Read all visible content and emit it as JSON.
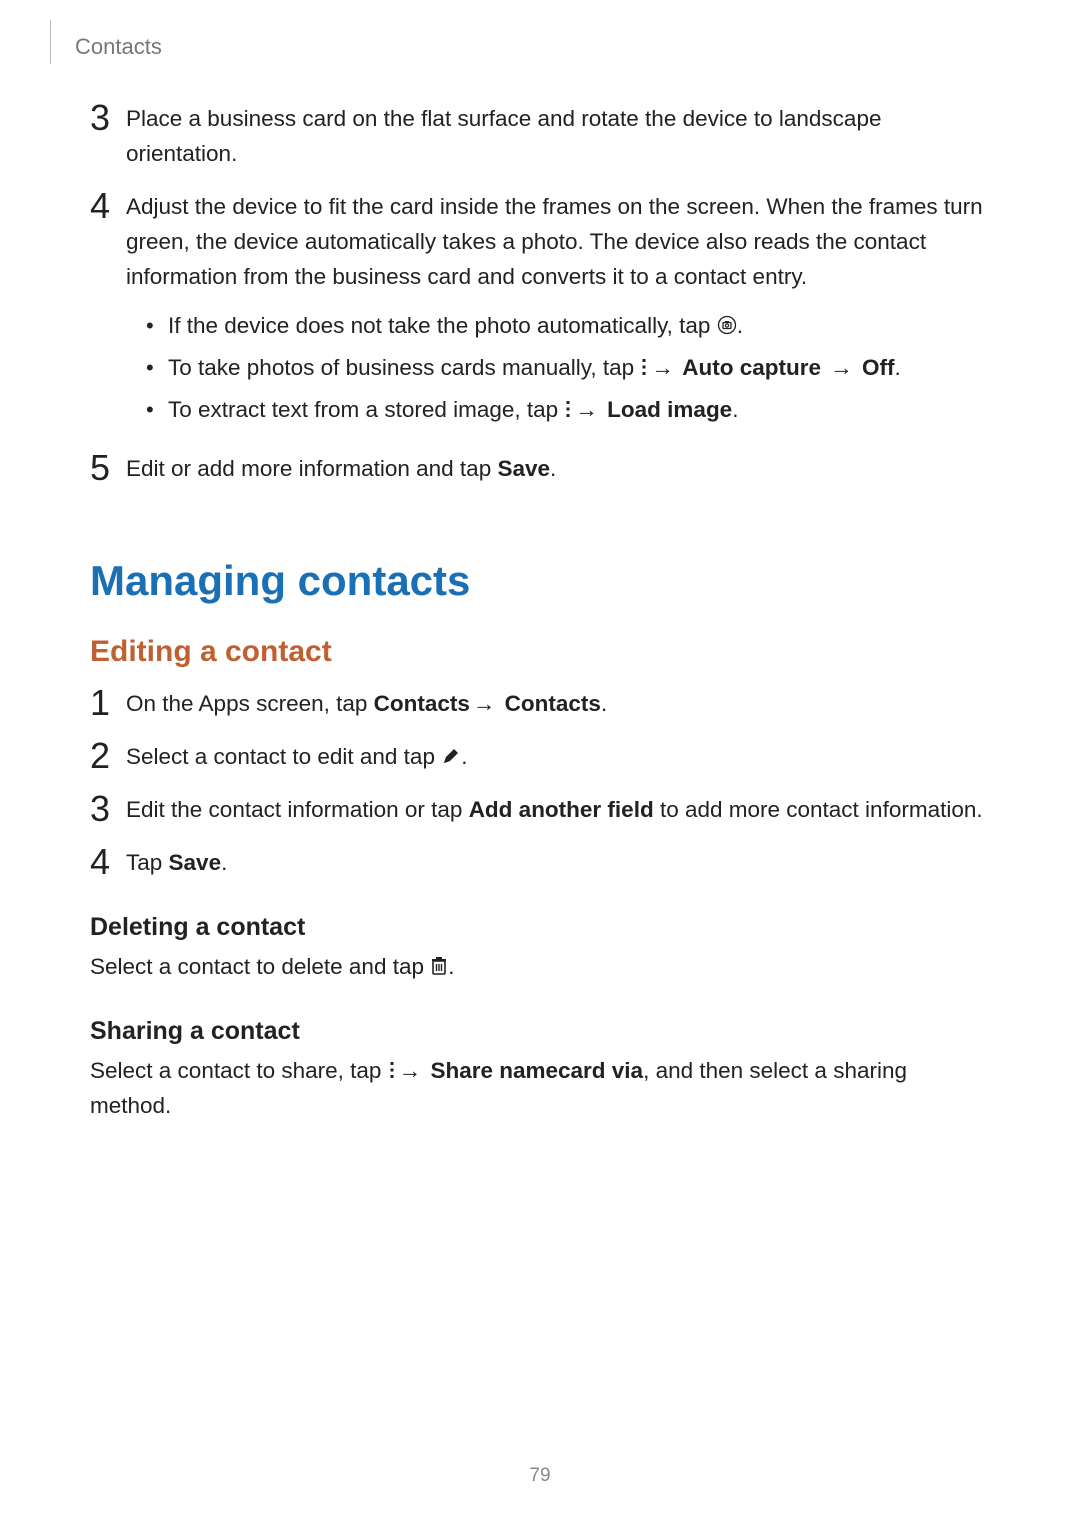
{
  "header": {
    "section": "Contacts"
  },
  "page_number": "79",
  "arrow": "→",
  "steps_top": {
    "3": "Place a business card on the flat surface and rotate the device to landscape orientation.",
    "4": {
      "lead": "Adjust the device to fit the card inside the frames on the screen. When the frames turn green, the device automatically takes a photo. The device also reads the contact information from the business card and converts it to a contact entry.",
      "b1_a": "If the device does not take the photo automatically, tap ",
      "b1_b": ".",
      "b2_a": "To take photos of business cards manually, tap ",
      "b2_b": " Auto capture ",
      "b2_c": " Off",
      "b2_d": ".",
      "b3_a": "To extract text from a stored image, tap ",
      "b3_b": " Load image",
      "b3_c": "."
    },
    "5_a": "Edit or add more information and tap ",
    "5_b": "Save",
    "5_c": "."
  },
  "h1": "Managing contacts",
  "h2_edit": "Editing a contact",
  "steps_edit": {
    "1_a": "On the Apps screen, tap ",
    "1_b": "Contacts",
    "1_c": " Contacts",
    "1_d": ".",
    "2_a": "Select a contact to edit and tap ",
    "2_b": ".",
    "3_a": "Edit the contact information or tap ",
    "3_b": "Add another field",
    "3_c": " to add more contact information.",
    "4_a": "Tap ",
    "4_b": "Save",
    "4_c": "."
  },
  "h3_delete": "Deleting a contact",
  "delete_a": "Select a contact to delete and tap ",
  "delete_b": ".",
  "h3_share": "Sharing a contact",
  "share_a": "Select a contact to share, tap ",
  "share_b": " Share namecard via",
  "share_c": ", and then select a sharing method."
}
